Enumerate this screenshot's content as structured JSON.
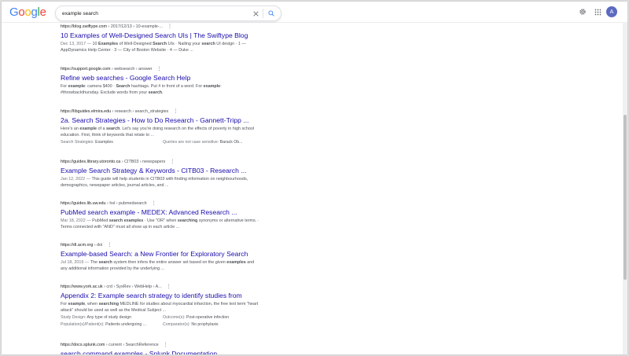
{
  "header": {
    "logo_text": "Google",
    "search": {
      "value": "example search",
      "placeholder": ""
    },
    "icons": {
      "clear": "close-icon",
      "search": "search-icon",
      "settings": "gear-icon",
      "apps": "apps-grid-icon"
    },
    "avatar_letter": "A"
  },
  "colors": {
    "link": "#1a0dab",
    "avatar": "#5c6bc0",
    "google_blue": "#4285f4",
    "google_red": "#ea4335",
    "google_yellow": "#fbbc05",
    "google_green": "#34a853"
  },
  "results": [
    {
      "url": "https://blog.swiftype.com",
      "path": " › 2017/12/13 › 10-example-...",
      "title": "10 Examples of Well-Designed Search UIs | The Swiftype Blog",
      "snippet_html": "<span class=\"date\">Dec 13, 2017 — </span>10 <b>Examples</b> of Well-Designed <b>Search</b> UIs · Nailing your <b>search</b> UI design · 1 — AppDynamics Help Center · 3 — City of Boston Website · 4 — Duke ..."
    },
    {
      "url": "https://support.google.com",
      "path": " › websearch › answer",
      "title": "Refine web searches - Google Search Help",
      "snippet_html": "For <b>example</b>: camera $400 · <b>Search</b> hashtags. Put # in front of a word. For <b>example</b>: #throwbackthursday. Exclude words from your <b>search</b>."
    },
    {
      "url": "https://libguides.elmira.edu",
      "path": " › research › search_strategies",
      "title": "2a. Search Strategies - How to Do Research - Gannett-Tripp ...",
      "snippet_html": "Here's an <b>example</b> of a <b>search</b>. Let's say you're doing research on the effects of poverty in high school education. First, think of keywords that relate to ...",
      "sub": [
        {
          "label": "Search Strategies: ",
          "value": "Examples"
        },
        {
          "label": "Queries are not case sensitive: ",
          "value": "Barack Ob..."
        }
      ]
    },
    {
      "url": "https://guides.library.utoronto.ca",
      "path": " › CITB03 › newspapers",
      "title": "Example Search Strategy & Keywords - CITB03 - Research ...",
      "snippet_html": "<span class=\"date\">Jan 12, 2022 — </span>This guide will help students in CITB03 with finding information on neighbourhoods, demographics, newspaper articles, journal articles, and ..."
    },
    {
      "url": "https://guides.lib.uw.edu",
      "path": " › hsl › pubmedsearch",
      "title": "PubMed search example - MEDEX: Advanced Research ...",
      "snippet_html": "<span class=\"date\">Mar 18, 2022 — </span>PubMed <b>search examples</b> · Use \"OR\" when <b>searching</b> synonyms or alternative terms. · Terms connected with \"AND\" must all show up in each article ..."
    },
    {
      "url": "https://dl.acm.org",
      "path": " › doi",
      "title": "Example-based Search: a New Frontier for Exploratory Search",
      "snippet_html": "<span class=\"date\">Jul 18, 2019 — </span>The <b>search</b> system then infers the entire answer set based on the given <b>examples</b> and any additional information provided by the underlying ..."
    },
    {
      "url": "https://www.york.ac.uk",
      "path": " › crd › SysRev › WebHelp › A...",
      "title": "Appendix 2: Example search strategy to identify studies from",
      "snippet_html": "For <b>example</b>, when <b>searching</b> MEDLINE for studies about myocardial infarction, the free text term \"heart attack\" should be used as well as the Medical Subject ...",
      "sub": [
        {
          "label": "Study Design: ",
          "value": "Any type of study design"
        },
        {
          "label": "Outcome(s): ",
          "value": "Post-operative infection"
        },
        {
          "label": "Population(s)/Patient(s): ",
          "value": "Patients undergoing ..."
        },
        {
          "label": "Comparator(s): ",
          "value": "No prophylaxis"
        }
      ]
    },
    {
      "url": "https://docs.splunk.com",
      "path": " › current › SearchReference",
      "title": "search command examples - Splunk Documentation",
      "snippet_html": ""
    }
  ]
}
